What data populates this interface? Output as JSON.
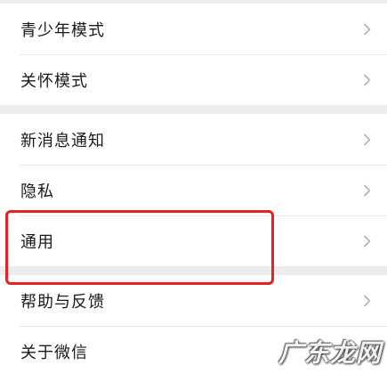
{
  "settings": {
    "group1": [
      {
        "label": "青少年模式",
        "icon": "chevron-right-icon"
      },
      {
        "label": "关怀模式",
        "icon": "chevron-right-icon"
      }
    ],
    "group2": [
      {
        "label": "新消息通知",
        "icon": "chevron-right-icon"
      },
      {
        "label": "隐私",
        "icon": "chevron-right-icon"
      },
      {
        "label": "通用",
        "icon": "chevron-right-icon"
      }
    ],
    "group3": [
      {
        "label": "帮助与反馈",
        "icon": "chevron-right-icon"
      },
      {
        "label": "关于微信",
        "icon": "chevron-right-icon"
      }
    ]
  },
  "annotation": {
    "highlight_color": "#e8201f"
  },
  "watermark": {
    "text": "广东龙网"
  }
}
